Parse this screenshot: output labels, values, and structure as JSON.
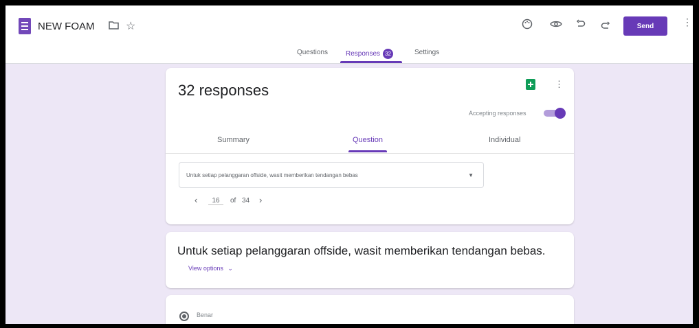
{
  "header": {
    "form_title": "NEW FOAM",
    "send_label": "Send"
  },
  "tabs": {
    "questions": "Questions",
    "responses": "Responses",
    "responses_badge": "32",
    "settings": "Settings"
  },
  "summary_card": {
    "count_text": "32 responses",
    "accepting_label": "Accepting responses",
    "accepting": true,
    "subtabs": {
      "summary": "Summary",
      "question": "Question",
      "individual": "Individual"
    },
    "question_select": "Untuk setiap pelanggaran offside, wasit memberikan tendangan bebas",
    "pager": {
      "current": "16",
      "of_label": "of",
      "total": "34"
    }
  },
  "question_card": {
    "title": "Untuk setiap pelanggaran offside, wasit memberikan tendangan bebas.",
    "view_options": "View options"
  },
  "answer_card": {
    "option_label": "Benar"
  },
  "icons": [
    "forms-logo-icon",
    "folder-icon",
    "star-icon",
    "palette-icon",
    "preview-icon",
    "undo-icon",
    "redo-icon",
    "more-vert-icon",
    "sheets-icon",
    "chevron-left-icon",
    "chevron-right-icon",
    "dropdown-arrow-icon",
    "chevron-down-icon",
    "radio-icon"
  ],
  "colors": {
    "accent": "#673ab7",
    "background": "#ede7f6",
    "sheets_green": "#0f9d58"
  }
}
